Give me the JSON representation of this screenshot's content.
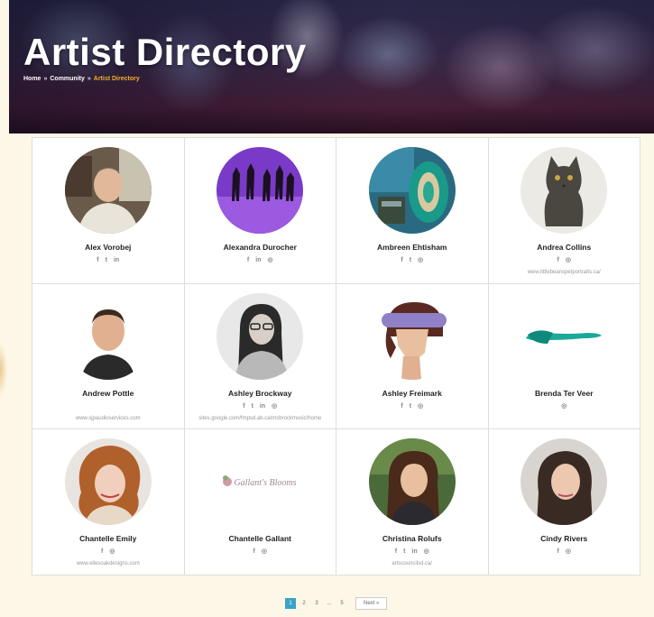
{
  "header": {
    "title": "Artist Directory",
    "breadcrumb": [
      {
        "label": "Home",
        "sep": "»"
      },
      {
        "label": "Community",
        "sep": "»"
      },
      {
        "label": "Artist Directory",
        "sep": ""
      }
    ]
  },
  "artists": [
    {
      "name": "Alex Vorobej",
      "socials": [
        "f",
        "t",
        "in"
      ],
      "site": ""
    },
    {
      "name": "Alexandra Durocher",
      "socials": [
        "f",
        "in",
        "◎"
      ],
      "site": ""
    },
    {
      "name": "Ambreen Ehtisham",
      "socials": [
        "f",
        "t",
        "◎"
      ],
      "site": ""
    },
    {
      "name": "Andrea Collins",
      "socials": [
        "f",
        "◎"
      ],
      "site": "www.littlebeanspetportraits.ca/"
    },
    {
      "name": "Andrew Pottle",
      "socials": [],
      "site": "www.sjpaudioservices.com"
    },
    {
      "name": "Ashley Brockway",
      "socials": [
        "f",
        "t",
        "in",
        "◎"
      ],
      "site": "sites.google.com/fmpsd.ab.ca/msbrockmusic/home"
    },
    {
      "name": "Ashley Freimark",
      "socials": [
        "f",
        "t",
        "◎"
      ],
      "site": ""
    },
    {
      "name": "Brenda Ter Veer",
      "socials": [
        "◎"
      ],
      "site": ""
    },
    {
      "name": "Chantelle Emily",
      "socials": [
        "f",
        "◎"
      ],
      "site": "www.ellesoakdesigns.com"
    },
    {
      "name": "Chantelle Gallant",
      "socials": [
        "f",
        "◎"
      ],
      "site": ""
    },
    {
      "name": "Christina Rolufs",
      "socials": [
        "f",
        "t",
        "in",
        "◎"
      ],
      "site": "artscouncilsd.ca/"
    },
    {
      "name": "Cindy Rivers",
      "socials": [
        "f",
        "◎"
      ],
      "site": ""
    }
  ],
  "logo_text": {
    "chantelle_gallant": "Gallant's Blooms"
  },
  "pagination": {
    "pages": [
      "1",
      "2",
      "3",
      "...",
      "5"
    ],
    "current": "1",
    "next_label": "Next »"
  }
}
